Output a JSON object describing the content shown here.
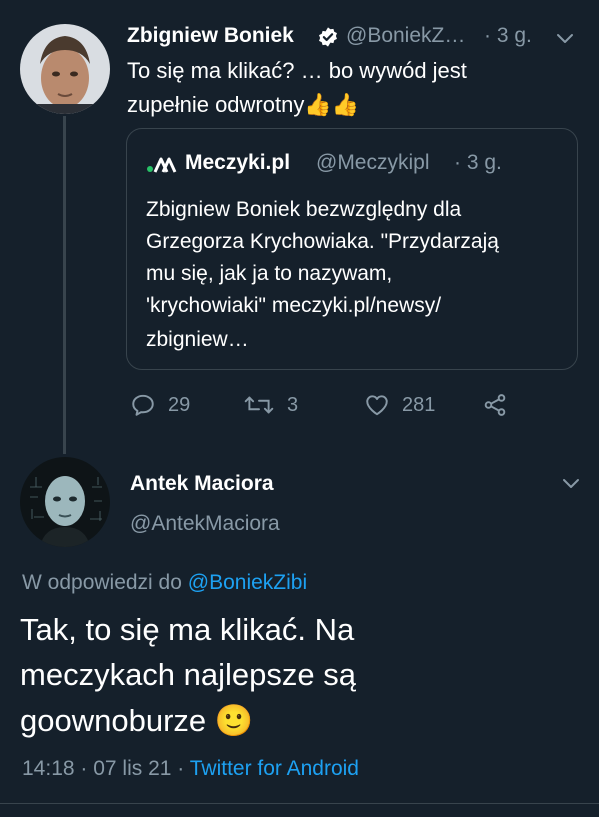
{
  "tweet": {
    "author_name": "Zbigniew Boniek",
    "handle": "@BoniekZ…",
    "time": "· 3 g.",
    "text_line1": "To się ma klikać? … bo wywód jest",
    "text_line2": "zupełnie odwrotny👍👍",
    "quote": {
      "source_name": "Meczyki.pl",
      "source_handle": "@Meczykipl",
      "time": "· 3 g.",
      "lines": [
        "Zbigniew Boniek bezwzględny dla",
        "Grzegorza Krychowiaka. \"Przydarzają",
        "mu się, jak ja to nazywam,",
        "'krychowiaki\" meczyki.pl/newsy/",
        "zbigniew…"
      ]
    },
    "actions": {
      "replies": "29",
      "retweets": "3",
      "likes": "281"
    }
  },
  "reply": {
    "author_name": "Antek Maciora",
    "handle": "@AntekMaciora",
    "in_reply_prefix": "W odpowiedzi do",
    "in_reply_handle": "@BoniekZibi",
    "text_line1": "Tak, to się ma klikać. Na",
    "text_line2": "meczykach najlepsze są",
    "text_line3": "goownoburze 🙂",
    "timestamp": "14:18 · 07 lis 21 ·",
    "client": "Twitter for Android"
  },
  "colors": {
    "background": "#15202b",
    "muted": "#8899a6",
    "link": "#1da1f2",
    "border": "#38444d",
    "verified": "#ffffff"
  }
}
